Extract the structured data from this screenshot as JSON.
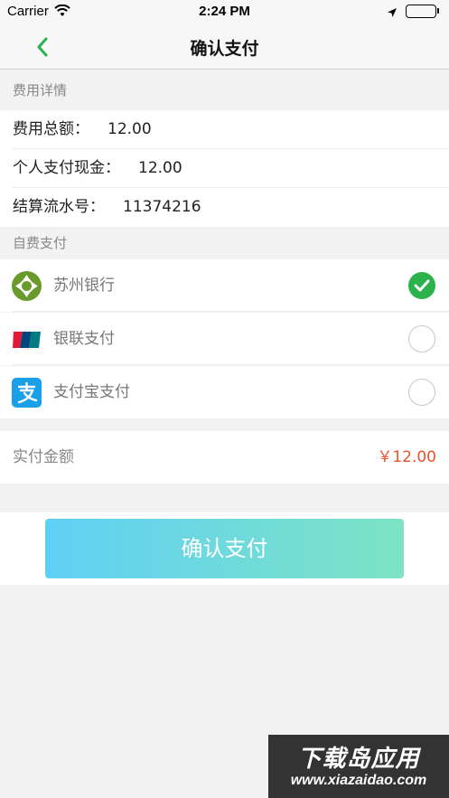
{
  "status_bar": {
    "carrier": "Carrier",
    "time": "2:24 PM",
    "battery_color": "#3cc83c"
  },
  "nav": {
    "back_icon": "chevron-left-icon",
    "title": "确认支付"
  },
  "fee_section": {
    "header": "费用详情",
    "rows": [
      {
        "label": "费用总额：",
        "value": "12.00"
      },
      {
        "label": "个人支付现金：",
        "value": "12.00"
      },
      {
        "label": "结算流水号：",
        "value": "11374216"
      }
    ]
  },
  "self_pay_section": {
    "header": "自费支付",
    "methods": [
      {
        "label": "苏州银行",
        "icon": "suzhou-bank-icon",
        "selected": true
      },
      {
        "label": "银联支付",
        "icon": "unionpay-icon",
        "selected": false
      },
      {
        "label": "支付宝支付",
        "icon": "alipay-icon",
        "selected": false
      }
    ]
  },
  "amount": {
    "label": "实付金额",
    "value": "￥12.00",
    "color": "#e8542c"
  },
  "confirm_button": {
    "label": "确认支付"
  },
  "watermark": {
    "title": "下载岛应用",
    "url": "www.xiazaidao.com"
  },
  "colors": {
    "accent_green": "#2bb24c",
    "button_gradient_start": "#5fd0f5",
    "button_gradient_end": "#7de3c4"
  }
}
